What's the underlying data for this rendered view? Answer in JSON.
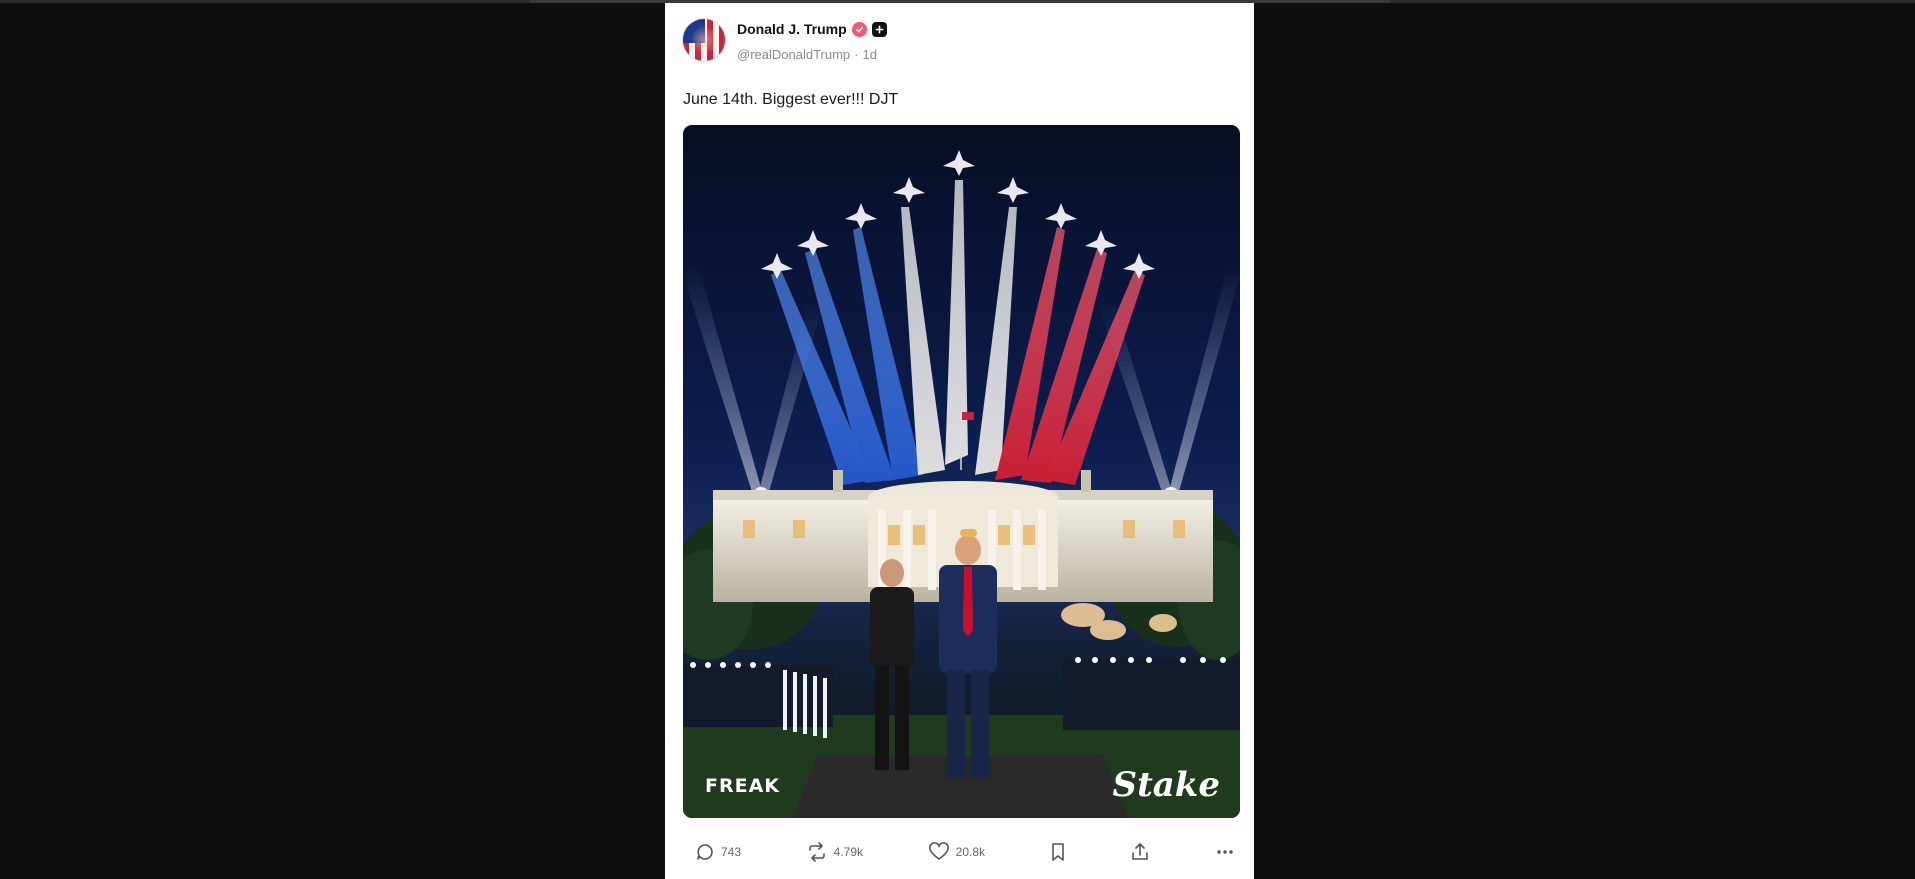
{
  "post": {
    "author_name": "Donald J. Trump",
    "handle": "@realDonaldTrump",
    "age": "1d",
    "separator": "·",
    "text": "June 14th. Biggest ever!!! DJT"
  },
  "media": {
    "watermark_left": "FREAK",
    "watermark_right": "Stake"
  },
  "actions": {
    "replies": "743",
    "reposts": "4.79k",
    "likes": "20.8k"
  },
  "icons": {
    "reply": "reply-icon",
    "repost": "repost-icon",
    "like": "heart-icon",
    "bookmark": "bookmark-icon",
    "share": "share-icon",
    "more": "more-icon"
  },
  "colors": {
    "page_bg": "#0e0e0e",
    "card_bg": "#ffffff",
    "verified": "#f0587a",
    "smoke_red": "#e0394b",
    "smoke_blue": "#2f6be0",
    "smoke_white": "#f2f2f2"
  }
}
